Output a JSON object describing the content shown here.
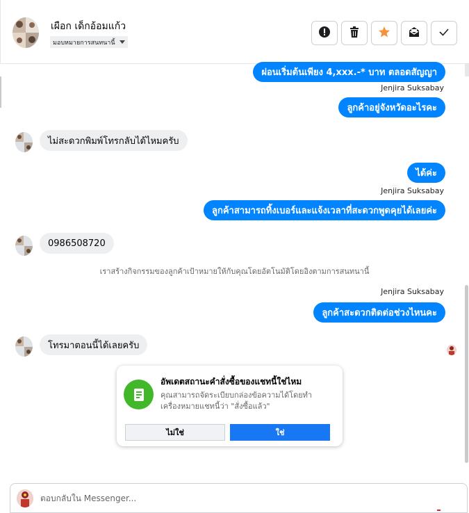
{
  "header": {
    "contact_name": "เผือก เด็กอ้อมแก้ว",
    "assign_label": "มอบหมายการสนทนานี้",
    "icons": [
      "alert-icon",
      "trash-icon",
      "star-icon",
      "mail-icon",
      "check-icon"
    ],
    "star_color": "#f7923a"
  },
  "messages": {
    "m1": "ผ่อนเริ่มต้นเพียง 4,xxx.-* บาท ตลอดสัญญา",
    "sender1": "Jenjira Suksabay",
    "m2": "ลูกค้าอยู่จังหวัดอะไรคะ",
    "m3": "ไม่สะดวกพิมพ์โทรกลับได้ไหมครับ",
    "m4": "ได้ค่ะ",
    "sender2": "Jenjira Suksabay",
    "m5": "ลูกค้าสามารถทิ้งเบอร์และแจ้งเวลาที่สะดวกพูดคุยได้เลยค่ะ",
    "m6": "0986508720",
    "system": "เราสร้างกิจกรรมของลูกค้าเป้าหมายให้กับคุณโดยอัตโนมัติโดยอิงตามการสนทนานี้",
    "sender3": "Jenjira Suksabay",
    "m7": "ลูกค้าสะดวกติดต่อช่วงไหนคะ",
    "m8": "โทรมาตอนนี้ได้เลยครับ"
  },
  "prompt_card": {
    "title": "อัพเดตสถานะคำสั่งซื้อของแชทนี้ใช่ไหม",
    "body": "คุณสามารถจัดระเบียบกล่องข้อความได้โดยทำเครื่องหมายแชทนี้ว่า \"สั่งซื้อแล้ว\"",
    "no_label": "ไม่ใช่",
    "yes_label": "ใช่",
    "icon": "order-list-icon"
  },
  "composer": {
    "placeholder": "ตอบกลับใน Messenger..."
  },
  "colors": {
    "outgoing_bubble": "#0084ff",
    "incoming_bubble": "#eeeff1",
    "card_icon_bg": "#42b72a",
    "primary_button": "#1877f2"
  }
}
